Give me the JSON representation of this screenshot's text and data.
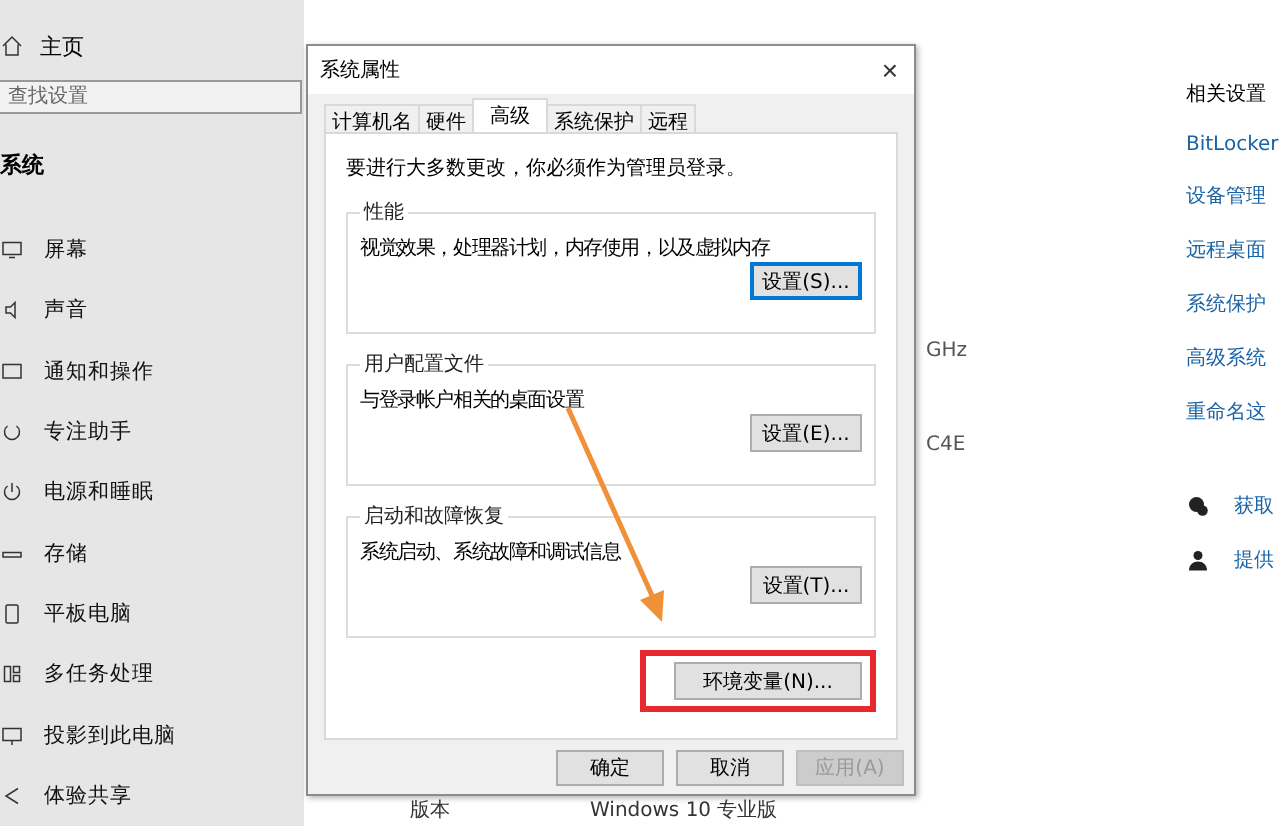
{
  "settings": {
    "home": "主页",
    "search": {
      "placeholder": "查找设置"
    },
    "section": "系统",
    "nav": [
      {
        "label": "屏幕"
      },
      {
        "label": "声音"
      },
      {
        "label": "通知和操作"
      },
      {
        "label": "专注助手"
      },
      {
        "label": "电源和睡眠"
      },
      {
        "label": "存储"
      },
      {
        "label": "平板电脑"
      },
      {
        "label": "多任务处理"
      },
      {
        "label": "投影到此电脑"
      },
      {
        "label": "体验共享"
      }
    ],
    "fragments": [
      "GHz",
      "C4E"
    ],
    "version": {
      "label": "版本",
      "value": "Windows 10 专业版"
    },
    "related": {
      "title": "相关设置",
      "links": [
        "BitLocker",
        "设备管理",
        "远程桌面",
        "系统保护",
        "高级系统",
        "重命名这"
      ]
    },
    "help": [
      "获取",
      "提供"
    ]
  },
  "dialog": {
    "title": "系统属性",
    "close": "×",
    "tabs": [
      {
        "label": "计算机名",
        "selected": false
      },
      {
        "label": "硬件",
        "selected": false
      },
      {
        "label": "高级",
        "selected": true
      },
      {
        "label": "系统保护",
        "selected": false
      },
      {
        "label": "远程",
        "selected": false
      }
    ],
    "note": "要进行大多数更改，你必须作为管理员登录。",
    "groups": [
      {
        "title": "性能",
        "text": "视觉效果，处理器计划，内存使用，以及虚拟内存",
        "button": "设置(S)...",
        "focused": true
      },
      {
        "title": "用户配置文件",
        "text": "与登录帐户相关的桌面设置",
        "button": "设置(E)...",
        "focused": false
      },
      {
        "title": "启动和故障恢复",
        "text": "系统启动、系统故障和调试信息",
        "button": "设置(T)...",
        "focused": false
      }
    ],
    "env_button": {
      "label": "环境变量(N)...",
      "highlighted": true
    },
    "footer": [
      {
        "label": "确定",
        "disabled": false
      },
      {
        "label": "取消",
        "disabled": false
      },
      {
        "label": "应用(A)",
        "disabled": true
      }
    ]
  }
}
